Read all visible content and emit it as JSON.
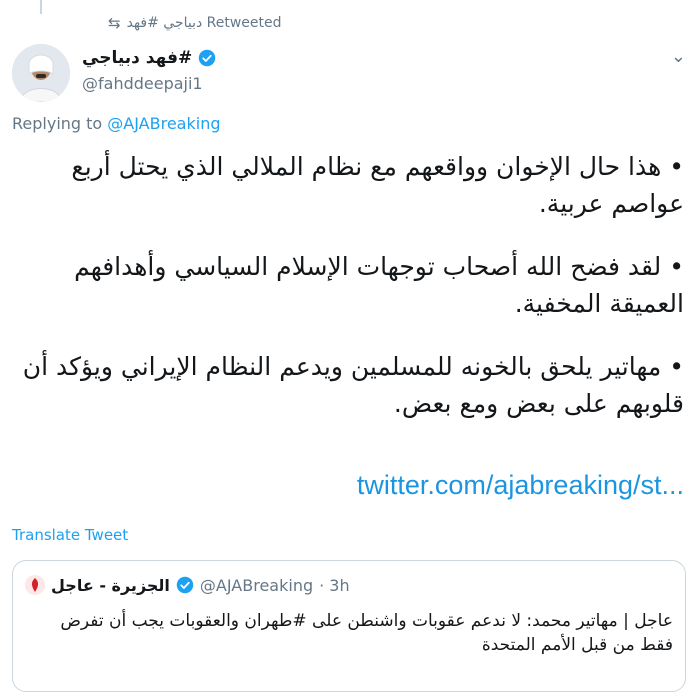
{
  "retweet": {
    "text": "دبياجي #فهد Retweeted",
    "icon": "retweet-icon"
  },
  "author": {
    "display_name": "#فهد دبياجي",
    "handle": "@fahddeepaji1"
  },
  "reply": {
    "prefix": "Replying to",
    "handle": "@AJABreaking"
  },
  "tweet": {
    "paragraphs": [
      "• هذا حال الإخوان وواقعهم مع نظام الملالي الذي يحتل أربع عواصم عربية.",
      "• لقد فضح الله أصحاب توجهات الإسلام السياسي وأهدافهم العميقة المخفية.",
      "• مهاتير يلحق بالخونه للمسلمين ويدعم النظام الإيراني ويؤكد أن قلوبهم على بعض ومع بعض."
    ],
    "link": "twitter.com/ajabreaking/st..."
  },
  "translate_label": "Translate Tweet",
  "quote": {
    "name": "الجزيرة - عاجل",
    "handle": "@AJABreaking",
    "time": "· 3h",
    "text": "عاجل | مهاتير محمد: لا ندعم عقوبات واشنطن على #طهران والعقوبات يجب أن تفرض فقط من قبل الأمم المتحدة"
  },
  "colors": {
    "accent": "#1da1f2",
    "muted": "#657786",
    "border": "#ccd6dd"
  }
}
